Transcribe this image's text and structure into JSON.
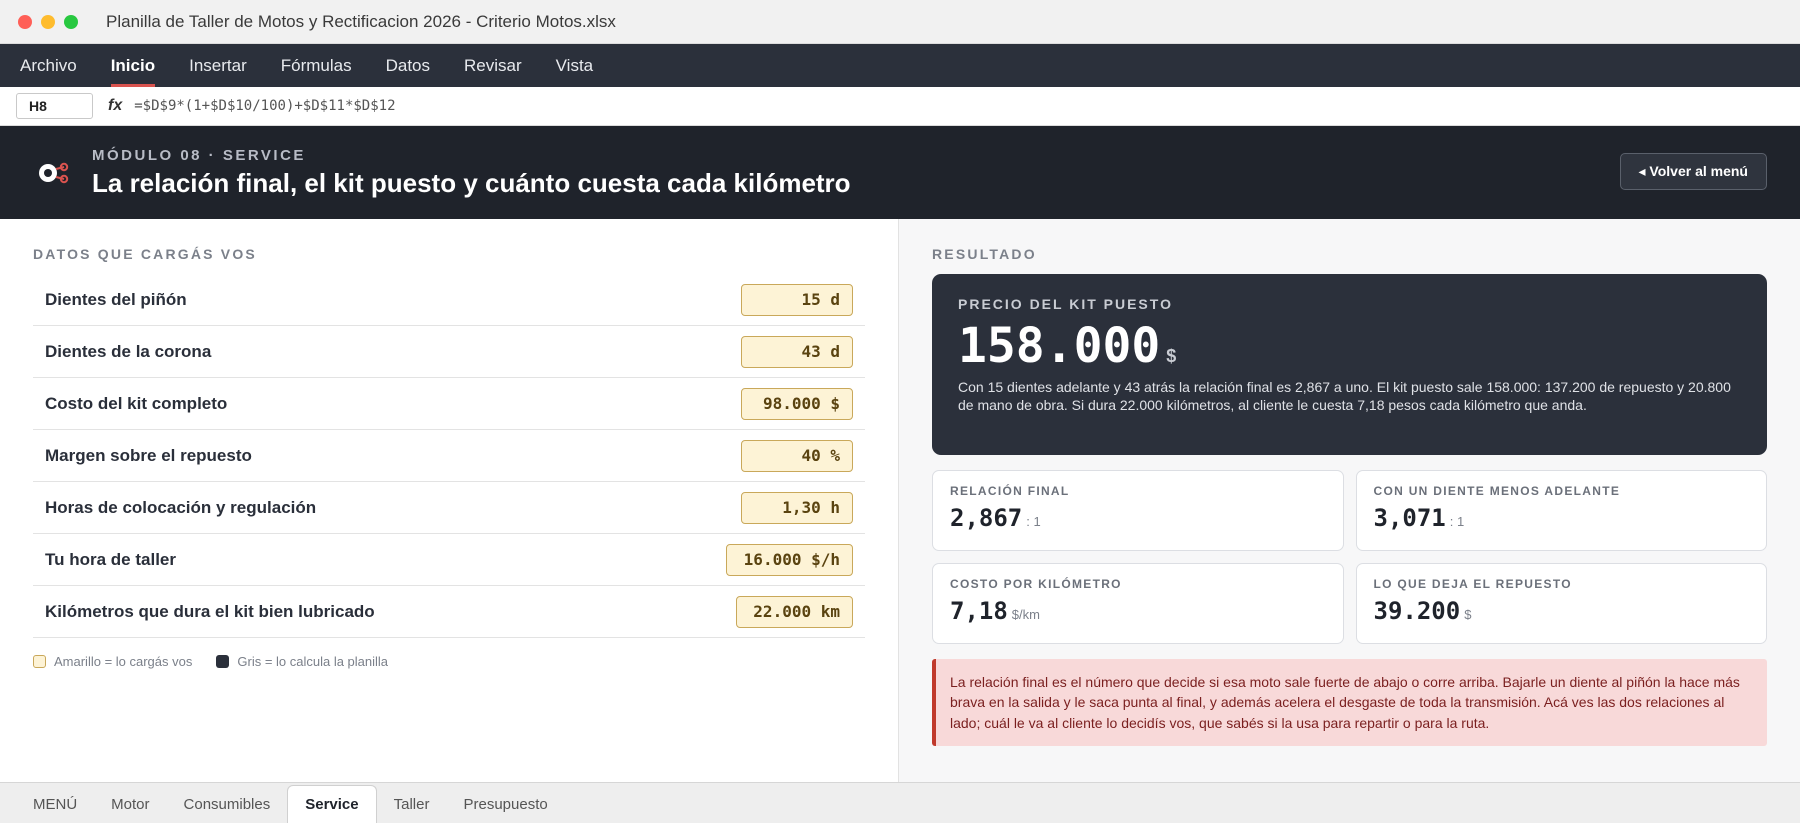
{
  "window": {
    "title": "Planilla de Taller de Motos y Rectificacion 2026 - Criterio Motos.xlsx",
    "dot_colors": [
      "#ff5f57",
      "#febc2e",
      "#28c840"
    ]
  },
  "menu": {
    "items": [
      "Archivo",
      "Inicio",
      "Insertar",
      "Fórmulas",
      "Datos",
      "Revisar",
      "Vista"
    ],
    "active": "Inicio"
  },
  "formula_bar": {
    "cell_ref": "H8",
    "fx_label": "fx",
    "formula": "=$D$9*(1+$D$10/100)+$D$11*$D$12"
  },
  "banner": {
    "module_tag": "MÓDULO 08 · SERVICE",
    "title": "La relación final, el kit puesto y cuánto cuesta cada kilómetro",
    "back_button": "◂ Volver al menú"
  },
  "inputs": {
    "section_title": "DATOS QUE CARGÁS VOS",
    "rows": [
      {
        "label": "Dientes del piñón",
        "value": "15 d"
      },
      {
        "label": "Dientes de la corona",
        "value": "43 d"
      },
      {
        "label": "Costo del kit completo",
        "value": "98.000 $"
      },
      {
        "label": "Margen sobre el repuesto",
        "value": "40 %"
      },
      {
        "label": "Horas de colocación y regulación",
        "value": "1,30 h"
      },
      {
        "label": "Tu hora de taller",
        "value": "16.000 $/h"
      },
      {
        "label": "Kilómetros que dura el kit bien lubricado",
        "value": "22.000 km"
      }
    ],
    "legend_input": "Amarillo = lo cargás vos",
    "legend_calc": "Gris = lo calcula la planilla"
  },
  "result": {
    "section_title": "RESULTADO",
    "hero": {
      "tag": "PRECIO DEL KIT PUESTO",
      "value": "158.000",
      "unit": "$",
      "description": "Con 15 dientes adelante y 43 atrás la relación final es 2,867 a uno. El kit puesto sale 158.000: 137.200 de repuesto y 20.800 de mano de obra. Si dura 22.000 kilómetros, al cliente le cuesta 7,18 pesos cada kilómetro que anda."
    },
    "cards": [
      {
        "tag": "RELACIÓN FINAL",
        "value": "2,867",
        "unit": ": 1"
      },
      {
        "tag": "CON UN DIENTE MENOS ADELANTE",
        "value": "3,071",
        "unit": ": 1"
      },
      {
        "tag": "COSTO POR KILÓMETRO",
        "value": "7,18",
        "unit": "$/km"
      },
      {
        "tag": "LO QUE DEJA EL REPUESTO",
        "value": "39.200",
        "unit": "$"
      }
    ],
    "note": "La relación final es el número que decide si esa moto sale fuerte de abajo o corre arriba. Bajarle un diente al piñón la hace más brava en la salida y le saca punta al final, y además acelera el desgaste de toda la transmisión. Acá ves las dos relaciones al lado; cuál le va al cliente lo decidís vos, que sabés si la usa para repartir o para la ruta."
  },
  "tabs": {
    "items": [
      "MENÚ",
      "Motor",
      "Consumibles",
      "Service",
      "Taller",
      "Presupuesto"
    ],
    "active": "Service"
  },
  "colors": {
    "accent": "#d9534f",
    "input_bg": "#fdf3d6",
    "calc_bg": "#2b303b"
  }
}
